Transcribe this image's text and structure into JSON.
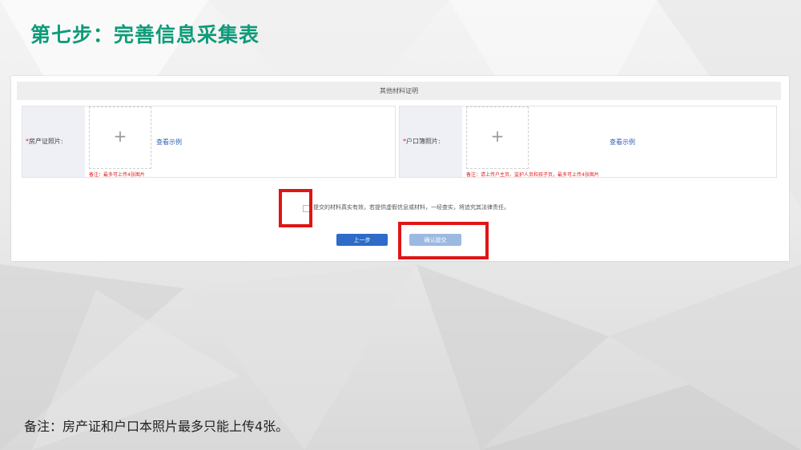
{
  "slide": {
    "title": "第七步：完善信息采集表",
    "footnote": "备注：房产证和户口本照片最多只能上传4张。"
  },
  "section": {
    "title": "其他材料证明"
  },
  "fields": [
    {
      "required_mark": "*",
      "label": "房产证照片:",
      "upload_symbol": "+",
      "view_link": "查看示例",
      "remark": "备注：最多可上传4张图片"
    },
    {
      "required_mark": "*",
      "label": "户口簿照片:",
      "upload_symbol": "+",
      "view_link": "查看示例",
      "remark": "备注：请上传户主页、监护人页和孩子页，最多可上传4张图片"
    }
  ],
  "agreement": {
    "text": "提交的材料真实有效，若提供虚假信息或材料，一经查实，将追究其法律责任。",
    "checked": false
  },
  "buttons": {
    "prev": "上一步",
    "submit": "确认提交"
  },
  "colors": {
    "title_green": "#0e9b79",
    "primary_blue": "#2d6cc8",
    "disabled_blue": "#9cb9e2",
    "highlight_red": "#e01515",
    "remark_red": "#e02020",
    "link_blue": "#2f5fb6"
  }
}
